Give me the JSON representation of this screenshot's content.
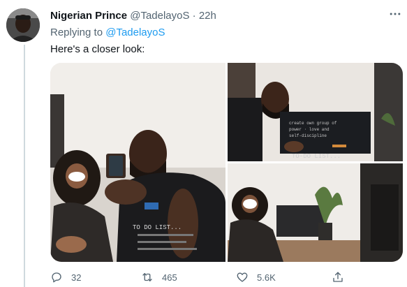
{
  "tweet": {
    "author_name": "Nigerian Prince",
    "author_handle": "@TadelayoS",
    "separator": "·",
    "time": "22h",
    "more_icon": "more-horizontal-icon",
    "reply_prefix": "Replying to",
    "reply_to": "@TadelayoS",
    "text": "Here's a closer look:"
  },
  "media": {
    "photos": [
      {
        "alt": "photo-1",
        "overlay_text": "TO DO LIST..."
      },
      {
        "alt": "photo-2",
        "overlay_lines": [
          "create own group of",
          "power · love and",
          "self-discipline",
          "TO-DO LIST..."
        ]
      },
      {
        "alt": "photo-3"
      }
    ]
  },
  "actions": {
    "reply": {
      "icon": "reply-icon",
      "count": "32"
    },
    "retweet": {
      "icon": "retweet-icon",
      "count": "465"
    },
    "like": {
      "icon": "heart-icon",
      "count": "5.6K"
    },
    "share": {
      "icon": "share-icon"
    }
  },
  "colors": {
    "link": "#1d9bf0",
    "secondary_text": "#536471",
    "primary_text": "#0f1419",
    "thread_line": "#cfd9de"
  }
}
